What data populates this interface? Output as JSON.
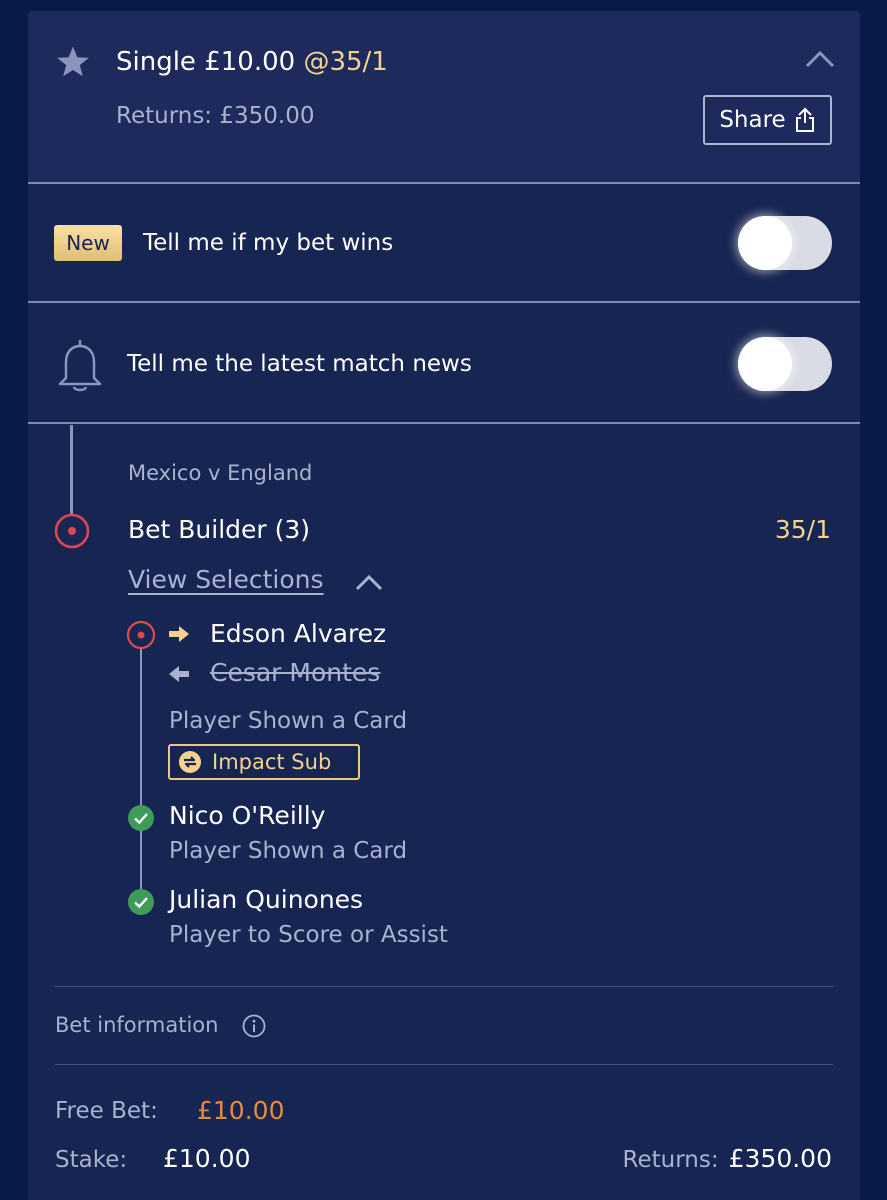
{
  "bet": {
    "title": "Single £10.00",
    "odds": "@35/1",
    "returns": "Returns: £350.00",
    "share_label": "Share"
  },
  "notify_win": {
    "badge": "New",
    "label": "Tell me if my bet wins",
    "enabled": false
  },
  "notify_news": {
    "label": "Tell me the latest match news",
    "enabled": false
  },
  "event": {
    "name": "Mexico v England",
    "market": "Bet Builder (3)",
    "odds": "35/1",
    "view_selections": "View Selections"
  },
  "selections": [
    {
      "player_in": "Edson Alvarez",
      "player_out": "Cesar Montes",
      "market": "Player Shown a Card",
      "badge": "Impact Sub",
      "status": "pending"
    },
    {
      "player": "Nico O'Reilly",
      "market": "Player Shown a Card",
      "status": "won"
    },
    {
      "player": "Julian Quinones",
      "market": "Player to Score or Assist",
      "status": "won"
    }
  ],
  "info": {
    "label": "Bet information"
  },
  "summary": {
    "free_bet_label": "Free Bet:",
    "free_bet_value": "£10.00",
    "stake_label": "Stake:",
    "stake_value": "£10.00",
    "returns_label": "Returns:",
    "returns_value": "£350.00"
  },
  "colors": {
    "background": "#0a1a47",
    "card": "#172552",
    "header": "#1d2a5b",
    "odds": "#f3d28d",
    "free_bet": "#e88a3c",
    "pending": "#e0474f",
    "won": "#3e9b5a"
  },
  "icons": [
    "star-icon",
    "chevron-up-icon",
    "share-icon",
    "bell-icon",
    "pending-dot-icon",
    "arrow-right-icon",
    "arrow-left-icon",
    "swap-icon",
    "check-icon",
    "info-icon"
  ]
}
